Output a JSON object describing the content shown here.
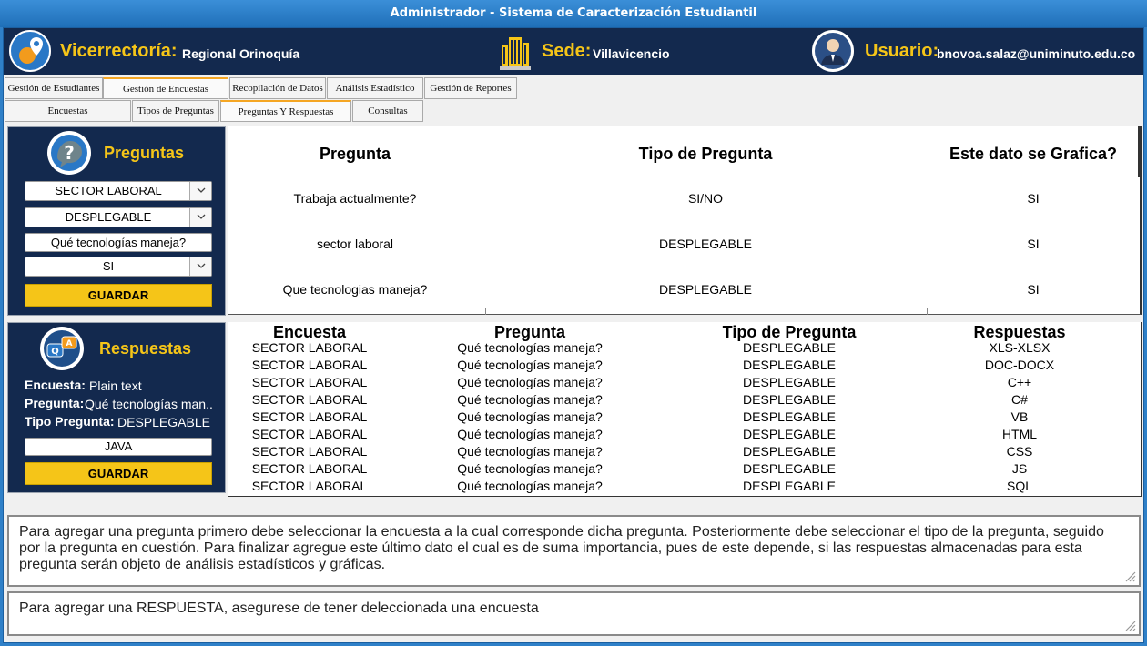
{
  "window": {
    "title": "Administrador - Sistema de Caracterización Estudiantil"
  },
  "header": {
    "vicerrectoria_label": "Vicerrectoría:",
    "vicerrectoria_value": "Regional Orinoquía",
    "sede_label": "Sede:",
    "sede_value": "Villavicencio",
    "usuario_label": "Usuario:",
    "usuario_value": "bnovoa.salaz@uniminuto.edu.co"
  },
  "main_tabs": [
    {
      "label": "Gestión de Estudiantes"
    },
    {
      "label": "Gestión de Encuestas"
    },
    {
      "label": "Recopilación de Datos"
    },
    {
      "label": "Análisis Estadístico"
    },
    {
      "label": "Gestión de Reportes"
    }
  ],
  "sub_tabs": [
    {
      "label": "Encuestas"
    },
    {
      "label": "Tipos de Preguntas"
    },
    {
      "label": "Preguntas Y Respuestas"
    },
    {
      "label": "Consultas"
    }
  ],
  "preguntas_panel": {
    "title": "Preguntas",
    "encuesta_select": "SECTOR LABORAL",
    "tipo_select": "DESPLEGABLE",
    "pregunta_input": "Qué tecnologías maneja?",
    "grafica_select": "SI",
    "save_label": "GUARDAR"
  },
  "preguntas_table": {
    "headers": [
      "Pregunta",
      "Tipo de Pregunta",
      "Este dato se Grafica?"
    ],
    "rows": [
      [
        "Trabaja actualmente?",
        "SI/NO",
        "SI"
      ],
      [
        "sector laboral",
        "DESPLEGABLE",
        "SI"
      ],
      [
        "Que tecnologias maneja?",
        "DESPLEGABLE",
        "SI"
      ]
    ]
  },
  "respuestas_panel": {
    "title": "Respuestas",
    "encuesta_label": "Encuesta:",
    "encuesta_value": "Plain text",
    "pregunta_label": "Pregunta:",
    "pregunta_value": "Qué tecnologías man..",
    "tipo_label": "Tipo Pregunta:",
    "tipo_value": "DESPLEGABLE",
    "respuesta_input": "JAVA",
    "save_label": "GUARDAR"
  },
  "respuestas_table": {
    "headers": [
      "Encuesta",
      "Pregunta",
      "Tipo de Pregunta",
      "Respuestas"
    ],
    "rows": [
      [
        "SECTOR LABORAL",
        "Qué tecnologías maneja?",
        "DESPLEGABLE",
        "XLS-XLSX"
      ],
      [
        "SECTOR LABORAL",
        "Qué tecnologías maneja?",
        "DESPLEGABLE",
        "DOC-DOCX"
      ],
      [
        "SECTOR LABORAL",
        "Qué tecnologías maneja?",
        "DESPLEGABLE",
        "C++"
      ],
      [
        "SECTOR LABORAL",
        "Qué tecnologías maneja?",
        "DESPLEGABLE",
        "C#"
      ],
      [
        "SECTOR LABORAL",
        "Qué tecnologías maneja?",
        "DESPLEGABLE",
        "VB"
      ],
      [
        "SECTOR LABORAL",
        "Qué tecnologías maneja?",
        "DESPLEGABLE",
        "HTML"
      ],
      [
        "SECTOR LABORAL",
        "Qué tecnologías maneja?",
        "DESPLEGABLE",
        "CSS"
      ],
      [
        "SECTOR LABORAL",
        "Qué tecnologías maneja?",
        "DESPLEGABLE",
        "JS"
      ],
      [
        "SECTOR LABORAL",
        "Qué tecnologías maneja?",
        "DESPLEGABLE",
        "SQL"
      ]
    ]
  },
  "help": {
    "preguntas_text": "Para agregar una pregunta primero debe seleccionar la encuesta a la cual corresponde dicha pregunta. Posteriormente debe seleccionar el tipo de la pregunta, seguido por la pregunta en cuestión. Para finalizar agregue este último dato el cual es de suma importancia, pues de este depende, si las respuestas almacenadas para esta pregunta serán objeto de análisis estadísticos y gráficas.",
    "respuestas_text": "Para agregar una RESPUESTA, asegurese de tener deleccionada una encuesta"
  },
  "colors": {
    "navy": "#13294e",
    "gold": "#f5c518",
    "titlebar": "#2f80c8"
  },
  "icons": [
    "map-pin-icon",
    "building-icon",
    "user-avatar-icon",
    "question-bubble-icon",
    "qa-bubbles-icon",
    "chevron-down-icon",
    "resize-grip-icon"
  ]
}
